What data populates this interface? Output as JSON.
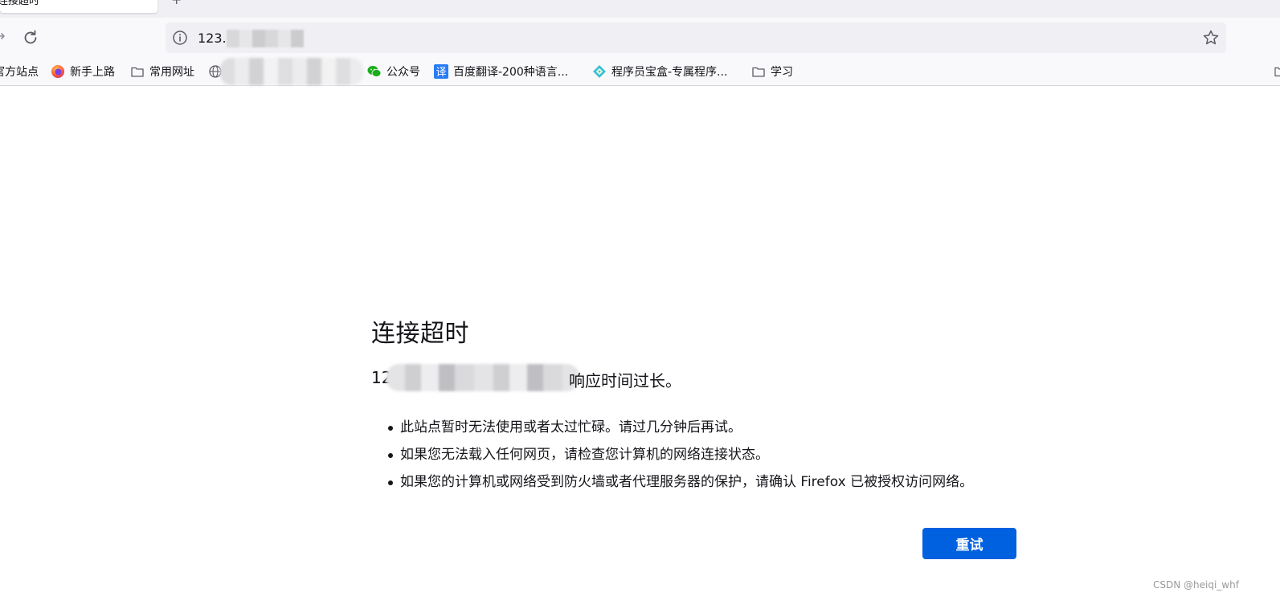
{
  "tab": {
    "title": "连接超时",
    "newtab_label": "+"
  },
  "navbar": {
    "url_text": "123."
  },
  "bookmarks": [
    {
      "label": "官方站点",
      "icon": "folder-icon"
    },
    {
      "label": "新手上路",
      "icon": "firefox-icon"
    },
    {
      "label": "常用网址",
      "icon": "folder-icon"
    },
    {
      "label": "公众号",
      "icon": "wechat-icon"
    },
    {
      "label": "百度翻译-200种语言...",
      "icon": "translate-icon"
    },
    {
      "label": "程序员宝盒-专属程序...",
      "icon": "toolbox-icon"
    },
    {
      "label": "学习",
      "icon": "folder-icon"
    }
  ],
  "error": {
    "title": "连接超时",
    "desc_prefix": "12",
    "desc_suffix": "响应时间过长。",
    "items": [
      "此站点暂时无法使用或者太过忙碌。请过几分钟后再试。",
      "如果您无法载入任何网页，请检查您计算机的网络连接状态。",
      "如果您的计算机或网络受到防火墙或者代理服务器的保护，请确认 Firefox 已被授权访问网络。"
    ],
    "retry_label": "重试"
  },
  "watermark": "CSDN @heiqi_whf",
  "colors": {
    "accent": "#0061e0",
    "toolbar": "#f9f9fb",
    "urlbar": "#f0f0f4",
    "text": "#15141a"
  }
}
